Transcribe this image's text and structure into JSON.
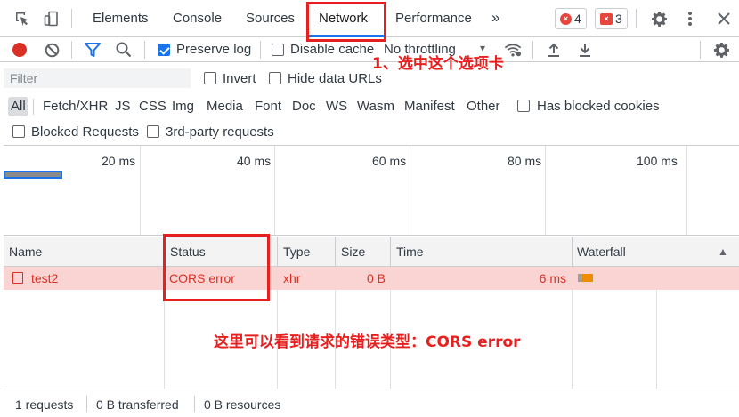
{
  "panel_tabs": {
    "items": [
      {
        "label": "Elements"
      },
      {
        "label": "Console"
      },
      {
        "label": "Sources"
      },
      {
        "label": "Network"
      },
      {
        "label": "Performance"
      }
    ],
    "more_label": "»",
    "error_count": "4",
    "issue_count": "3",
    "error_glyph": "×",
    "issue_glyph": "×"
  },
  "toolbar": {
    "preserve_log": "Preserve log",
    "disable_cache": "Disable cache",
    "throttling": "No throttling",
    "throttling_arrow": "▾"
  },
  "filter": {
    "placeholder": "Filter",
    "invert": "Invert",
    "hide_data_urls": "Hide data URLs"
  },
  "type_filters": [
    "All",
    "Fetch/XHR",
    "JS",
    "CSS",
    "Img",
    "Media",
    "Font",
    "Doc",
    "WS",
    "Wasm",
    "Manifest",
    "Other"
  ],
  "has_blocked_cookies": "Has blocked cookies",
  "blocked_requests": "Blocked Requests",
  "third_party": "3rd-party requests",
  "overview": {
    "ticks": [
      "20 ms",
      "40 ms",
      "60 ms",
      "80 ms",
      "100 ms"
    ]
  },
  "table": {
    "headers": {
      "name": "Name",
      "status": "Status",
      "type": "Type",
      "size": "Size",
      "time": "Time",
      "waterfall": "Waterfall",
      "sort_arrow": "▲"
    },
    "rows": [
      {
        "name": "test2",
        "status": "CORS error",
        "type": "xhr",
        "size": "0 B",
        "time": "6 ms"
      }
    ]
  },
  "statusbar": {
    "requests": "1 requests",
    "transferred": "0 B transferred",
    "resources": "0 B resources"
  },
  "annotations": {
    "select_tab": "1、选中这个选项卡",
    "error_note": "这里可以看到请求的错误类型：CORS error"
  },
  "colors": {
    "accent": "#1a73e8",
    "error_row": "#fad4d2",
    "error_text": "#d93025",
    "annotation": "#e81f1f"
  }
}
